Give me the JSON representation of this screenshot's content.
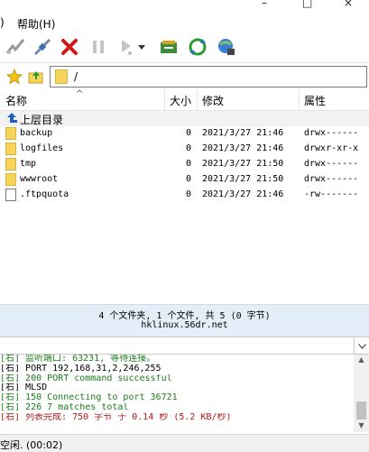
{
  "window": {
    "minimize": "–",
    "maximize": "□",
    "close": "×"
  },
  "menu": {
    "items": [
      ")",
      "帮助(H)"
    ]
  },
  "toolbar": {
    "buttons": [
      "connect-icon",
      "disconnect-icon",
      "stop-icon",
      "pause-icon",
      "play-icon",
      "transfer-icon",
      "refresh-icon",
      "globe-icon"
    ]
  },
  "address": {
    "path": "/"
  },
  "list": {
    "columns": {
      "name": "名称",
      "size": "大小",
      "modified": "修改",
      "attrs": "属性"
    },
    "parent_label": "上层目录",
    "rows": [
      {
        "name": "backup",
        "size": "0",
        "modified": "2021/3/27 21:46",
        "attrs": "drwx------",
        "type": "folder"
      },
      {
        "name": "logfiles",
        "size": "0",
        "modified": "2021/3/27 21:46",
        "attrs": "drwxr-xr-x",
        "type": "folder"
      },
      {
        "name": "tmp",
        "size": "0",
        "modified": "2021/3/27 21:50",
        "attrs": "drwx------",
        "type": "folder"
      },
      {
        "name": "wwwroot",
        "size": "0",
        "modified": "2021/3/27 21:50",
        "attrs": "drwx------",
        "type": "folder"
      },
      {
        "name": ".ftpquota",
        "size": "0",
        "modified": "2021/3/27 21:46",
        "attrs": "-rw-------",
        "type": "file"
      }
    ]
  },
  "status": {
    "summary": "4 个文件夹, 1 个文件, 共 5 (0 字节)",
    "host": "hklinux.56dr.net"
  },
  "log": {
    "lines": [
      {
        "text": "[右] 监听端口: 63231, 等待连接。",
        "color": "#1a7a1a"
      },
      {
        "text": "[右] PORT 192,168,31,2,246,255",
        "color": "#000000"
      },
      {
        "text": "[右] 200 PORT command successful",
        "color": "#1a7a1a"
      },
      {
        "text": "[右] MLSD",
        "color": "#000000"
      },
      {
        "text": "[右] 150 Connecting to port 36721",
        "color": "#1a7a1a"
      },
      {
        "text": "[右] 226 7 matches total",
        "color": "#1a7a1a"
      },
      {
        "text": "[右] 列表完成: 750 字节 于 0.14 秒 (5.2 KB/秒)",
        "color": "#b01515"
      }
    ]
  },
  "statusbar": {
    "text": "空闲. (00:02)"
  }
}
